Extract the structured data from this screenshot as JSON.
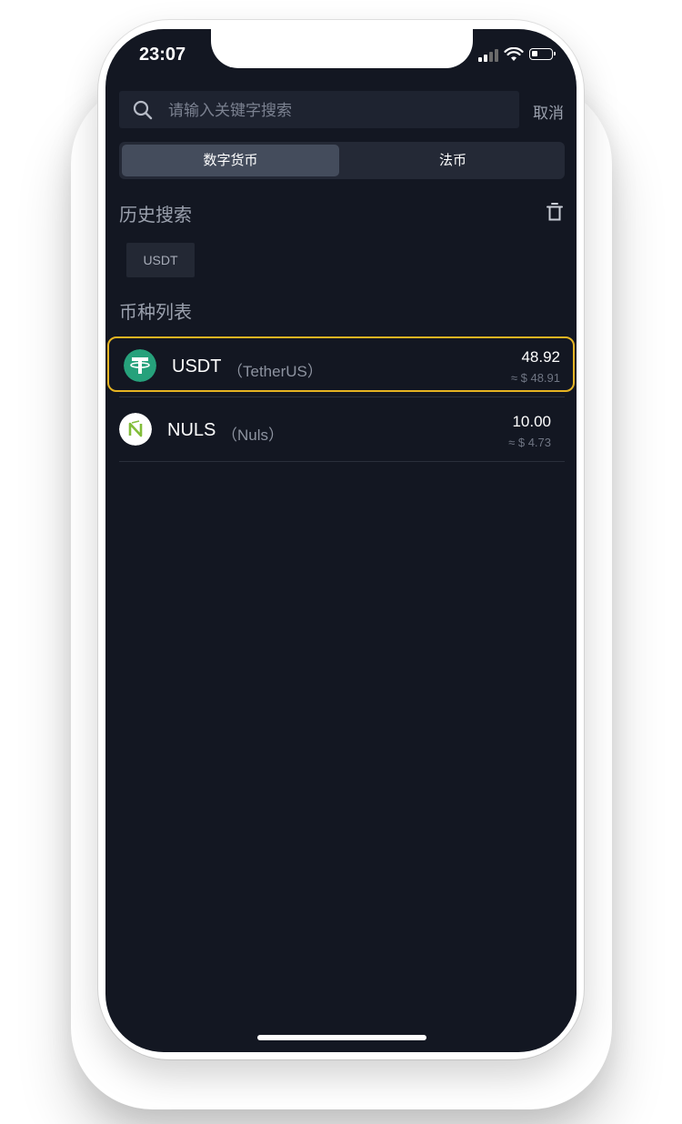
{
  "status_bar": {
    "time": "23:07"
  },
  "search": {
    "placeholder": "请输入关键字搜索",
    "value": "",
    "cancel_label": "取消"
  },
  "tabs": [
    {
      "label": "数字货币",
      "active": true
    },
    {
      "label": "法币",
      "active": false
    }
  ],
  "history": {
    "title": "历史搜索",
    "items": [
      {
        "label": "USDT"
      }
    ]
  },
  "coin_list": {
    "title": "币种列表",
    "items": [
      {
        "symbol": "USDT",
        "name": "（TetherUS）",
        "amount": "48.92",
        "value": "≈ $  48.91",
        "logo": "tether-logo",
        "highlighted": true
      },
      {
        "symbol": "NULS",
        "name": "（Nuls）",
        "amount": "10.00",
        "value": "≈ $  4.73",
        "logo": "nuls-logo",
        "highlighted": false
      }
    ]
  },
  "colors": {
    "background": "#131722",
    "highlight_border": "#e6b422",
    "tether_green": "#26a17b",
    "nuls_green": "#82bd39"
  }
}
